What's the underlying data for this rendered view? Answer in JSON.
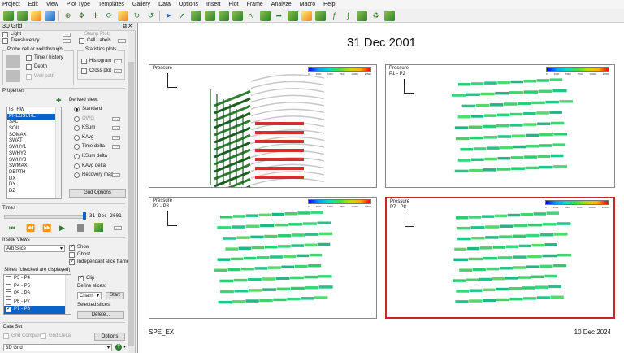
{
  "menu": [
    "Project",
    "Edit",
    "View",
    "Plot Type",
    "Templates",
    "Gallery",
    "Data",
    "Options",
    "Insert",
    "Plot",
    "Frame",
    "Analyze",
    "Macro",
    "Help"
  ],
  "panel": {
    "title": "3D Grid",
    "top_options": {
      "light": "Light",
      "translucency": "Translucency",
      "stamp_plots": "Stamp Plots",
      "cell_labels": "Cell Labels"
    },
    "probe_group": {
      "title": "Probe cell or well through",
      "time_history": "Time / history",
      "depth": "Depth",
      "well_path": "Well path"
    },
    "stats_group": {
      "title": "Statistics plots",
      "histogram": "Histogram",
      "cross_plot": "Cross plot"
    },
    "properties_label": "Properties",
    "properties": [
      "ISTHW",
      "PRESSURE",
      "SALT",
      "SOIL",
      "SOMAX",
      "SWAT",
      "SWHY1",
      "SWHY2",
      "SWHY3",
      "SWMAX",
      "DEPTH",
      "DX",
      "DY",
      "DZ"
    ],
    "selected_property": "PRESSURE",
    "derived_label": "Derived view:",
    "derived": [
      "Standard",
      "OWG",
      "KSum",
      "KAvg",
      "Time delta",
      "KSum delta",
      "KAvg delta",
      "Recovery map"
    ],
    "grid_options": "Grid Options",
    "times_label": "Times",
    "time_value": "31 Dec 2001",
    "inside_views_label": "Inside Views",
    "inside_mode": "Arb Slice",
    "show": "Show",
    "ghost": "Ghost",
    "independent": "Independant slice frames",
    "slices_label": "Slices (checked are displayed)",
    "slices": [
      "P3 - P4",
      "P4 - P5",
      "P5 - P6",
      "P6 - P7",
      "P7 - P8"
    ],
    "clip": "Clip",
    "define_slices": "Define slices:",
    "define_mode": "Chain",
    "start": "Start",
    "selected_slices": "Selected slices:",
    "delete": "Delete...",
    "data_set_label": "Data Set",
    "grid_compare": "Grid Compare",
    "grid_delta": "Grid Delta",
    "options": "Options",
    "bottom_select": "3D Grid"
  },
  "plot": {
    "title": "31 Dec 2001",
    "footer_left": "SPE_EX",
    "footer_right": "10 Dec 2024",
    "colorbar_ticks": [
      "0",
      "2500",
      "5000",
      "7500",
      "10000",
      "12500"
    ],
    "views": [
      {
        "label": "Pressure",
        "sublabel": ""
      },
      {
        "label": "Pressure",
        "sublabel": "P1 - P2"
      },
      {
        "label": "Pressure",
        "sublabel": "P2 - P3"
      },
      {
        "label": "Pressure",
        "sublabel": "P7 - P8"
      }
    ]
  }
}
